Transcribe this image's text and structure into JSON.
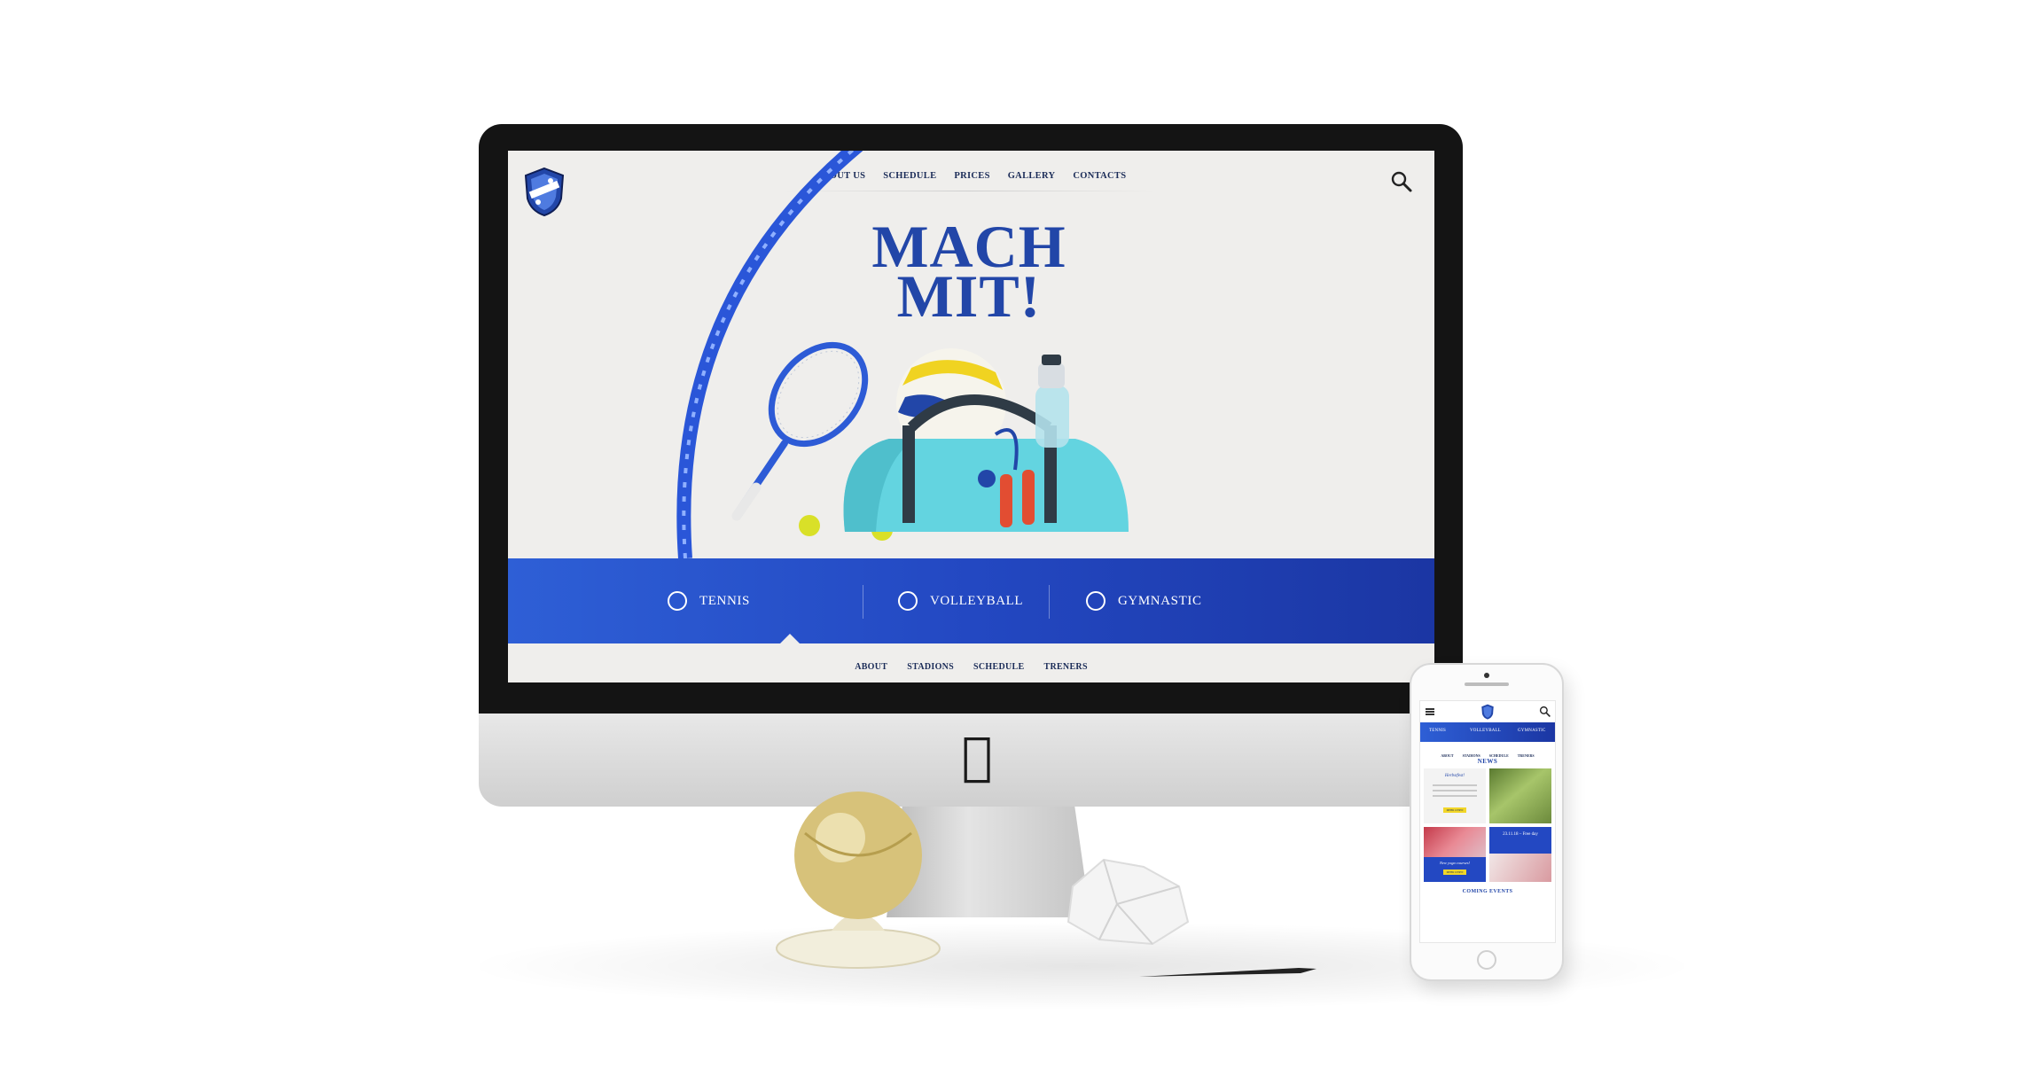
{
  "desktop": {
    "nav": [
      "ABOUT US",
      "SCHEDULE",
      "PRICES",
      "GALLERY",
      "CONTACTS"
    ],
    "hero_title": [
      "MACH",
      "MIT!"
    ],
    "categories": [
      "TENNIS",
      "VOLLEYBALL",
      "GYMNASTIC"
    ],
    "subnav": [
      "ABOUT",
      "STADIONS",
      "SCHEDULE",
      "TRENERS"
    ]
  },
  "mobile": {
    "categories": [
      "TENNIS",
      "VOLLEYBALL",
      "GYMNASTIC"
    ],
    "subnav": [
      "ABOUT",
      "STADIONS",
      "SCHEDULE",
      "TRENERS"
    ],
    "news_title": "NEWS",
    "card_title": "Herbstfest!",
    "card_button": "MEHR LESEN",
    "event_date": "23.11.18 – Free day",
    "yoga_title": "New yoga courses!",
    "yoga_button": "MEHR LESEN",
    "coming_title": "COMING EVENTS"
  },
  "colors": {
    "brand_blue": "#2348c2",
    "title_blue": "#2246a8",
    "navy": "#1b2c58",
    "button_yellow": "#f2d628",
    "screen_bg": "#efeeec"
  },
  "icons": [
    "logo-shield",
    "search-icon",
    "tennis-ball-icon",
    "volleyball-icon",
    "gymnastic-ball-icon",
    "menu-icon",
    "apple-logo"
  ]
}
